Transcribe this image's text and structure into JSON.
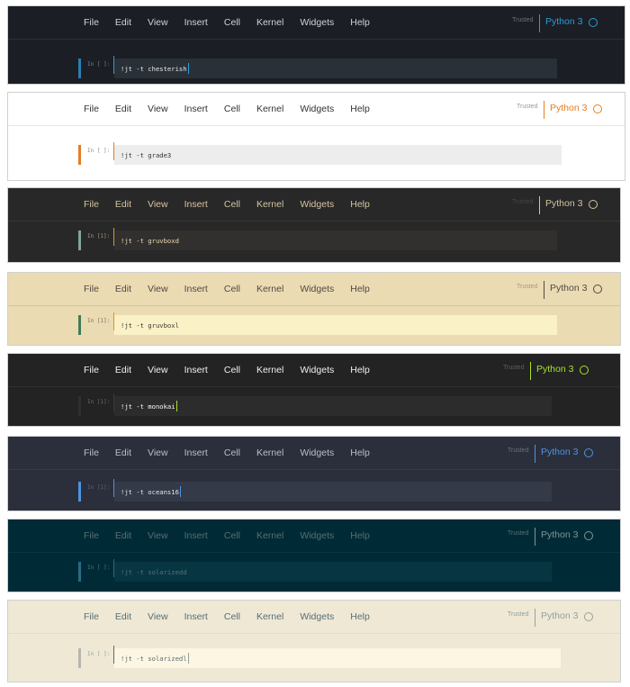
{
  "menu": [
    "File",
    "Edit",
    "View",
    "Insert",
    "Cell",
    "Kernel",
    "Widgets",
    "Help"
  ],
  "trusted_label": "Trusted",
  "kernel_name": "Python 3",
  "themes": [
    {
      "prompt": "In [ ]:",
      "command": "!jt -t chesterish",
      "colors": {
        "bg": "#1b1e25",
        "menu": "#cfd3d8",
        "line": "#2b3038",
        "trusted": "#6a737d",
        "kernel": "#2a9fd6",
        "accent": "#2a9fd6",
        "cellbar": "#2a7eb3",
        "cell": "#2a3038",
        "prompt": "#7a828a",
        "code": "#e6e6e6",
        "sep": "#2a9fd6"
      }
    },
    {
      "prompt": "In [ ]:",
      "command": "!jt -t grade3",
      "colors": {
        "bg": "#ffffff",
        "menu": "#333333",
        "line": "#e7e7e7",
        "trusted": "#9a9a9a",
        "kernel": "#e67e22",
        "accent": "#e67e22",
        "cellbar": "#e67e22",
        "cell": "#ededed",
        "prompt": "#888888",
        "code": "#333333",
        "sep": "#e67e22"
      }
    },
    {
      "prompt": "In [1]:",
      "command": "!jt -t gruvboxd",
      "colors": {
        "bg": "#282828",
        "menu": "#d5c4a1",
        "line": "#3c3836",
        "trusted": "#4a4542",
        "kernel": "#d5c4a1",
        "accent": "#d5c4a1",
        "cellbar": "#83a598",
        "cell": "#32302f",
        "prompt": "#a89984",
        "code": "#ebdbb2",
        "sep": "#d79921"
      }
    },
    {
      "prompt": "In [1]:",
      "command": "!jt -t gruvboxl",
      "colors": {
        "bg": "#ebdbb2",
        "menu": "#504945",
        "line": "#d5c4a1",
        "trusted": "#a89984",
        "kernel": "#504945",
        "accent": "#504945",
        "cellbar": "#427b58",
        "cell": "#fbf1c7",
        "prompt": "#7c6f64",
        "code": "#3c3836",
        "sep": "#d79921"
      }
    },
    {
      "prompt": "In [1]:",
      "command": "!jt -t monokai",
      "colors": {
        "bg": "#232323",
        "menu": "#f0f0f0",
        "line": "#2f2f2f",
        "trusted": "#5e5e5e",
        "kernel": "#a6e22e",
        "accent": "#a6e22e",
        "cellbar": "#2f2f2f",
        "cell": "#2c2c2c",
        "prompt": "#6b6b6b",
        "code": "#f8f8f2",
        "sep": "#3a3a3a"
      }
    },
    {
      "prompt": "In [1]:",
      "command": "!jt -t oceans16",
      "colors": {
        "bg": "#2b2f3b",
        "menu": "#b8bec8",
        "line": "#363b48",
        "trusted": "#6a717d",
        "kernel": "#4f93e0",
        "accent": "#4f93e0",
        "cellbar": "#4f93e0",
        "cell": "#343a47",
        "prompt": "#5e6572",
        "code": "#e0e4ea",
        "sep": "#4f93e0"
      }
    },
    {
      "prompt": "In [ ]:",
      "command": "!jt -t solarizedd",
      "colors": {
        "bg": "#002b36",
        "menu": "#586e75",
        "line": "#073642",
        "trusted": "#586e75",
        "kernel": "#839496",
        "accent": "#839496",
        "cellbar": "#2a6a82",
        "cell": "#073642",
        "prompt": "#586e75",
        "code": "#586e75",
        "sep": "#2a6a82"
      }
    },
    {
      "prompt": "In [ ]:",
      "command": "!jt -t solarizedl",
      "colors": {
        "bg": "#eee8d5",
        "menu": "#586e75",
        "line": "#e4dcc4",
        "trusted": "#93a1a1",
        "kernel": "#93a1a1",
        "accent": "#93a1a1",
        "cellbar": "#b5b5b5",
        "cell": "#fdf6e3",
        "prompt": "#93a1a1",
        "code": "#586e75",
        "sep": "#586e75"
      }
    }
  ]
}
